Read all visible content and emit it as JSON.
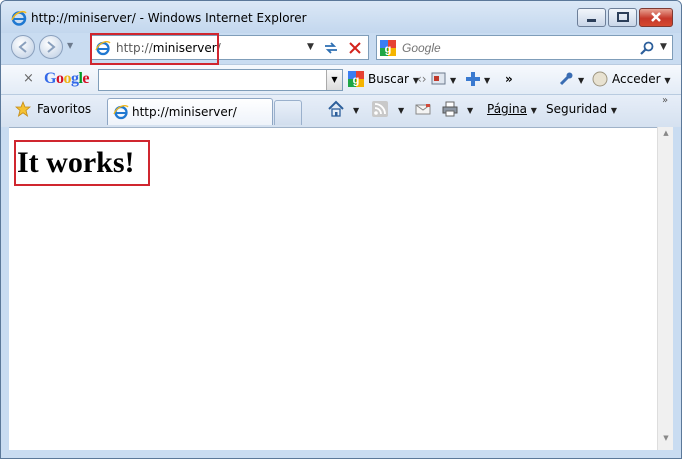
{
  "window": {
    "title": "http://miniserver/ - Windows Internet Explorer"
  },
  "address_bar": {
    "prefix": "http://",
    "host": "miniserver",
    "suffix": "/"
  },
  "search": {
    "placeholder": "Google"
  },
  "google_toolbar": {
    "logo": "Google",
    "search_label": "Buscar",
    "signin_label": "Acceder",
    "more": "»"
  },
  "tabs": {
    "favorites_label": "Favoritos",
    "active_tab_label": "http://miniserver/"
  },
  "command_bar": {
    "page_label": "Página",
    "security_label": "Seguridad",
    "more": "»"
  },
  "page": {
    "heading": "It works!"
  },
  "colors": {
    "highlight": "#d0262f",
    "frame": "#c9dcf1"
  }
}
